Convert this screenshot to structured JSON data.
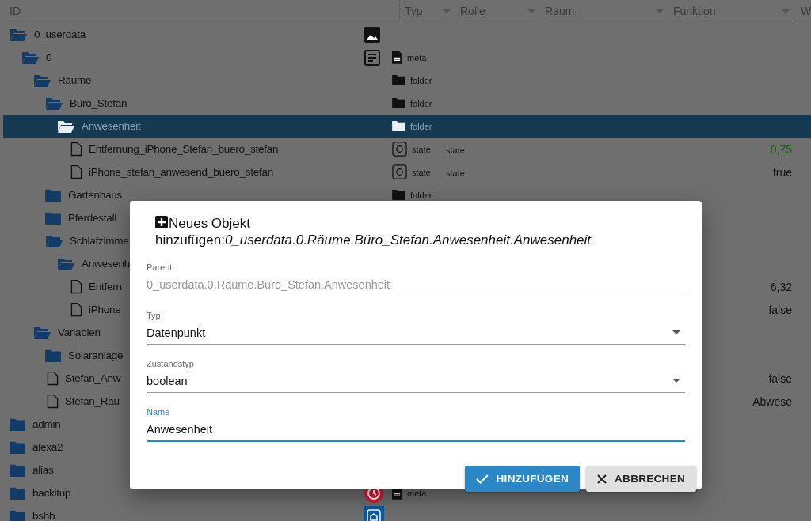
{
  "header": {
    "columns": [
      {
        "label": "ID",
        "kind": "text"
      },
      {
        "label": "Typ",
        "kind": "select"
      },
      {
        "label": "Rolle",
        "kind": "select"
      },
      {
        "label": "Raum",
        "kind": "select"
      },
      {
        "label": "Funktion",
        "kind": "select"
      },
      {
        "label": "W",
        "kind": "text"
      }
    ]
  },
  "tree": [
    {
      "name": "0_userdata",
      "kind": "folder",
      "expanded": true,
      "selected": false,
      "children": [
        {
          "name": "0",
          "kind": "folder",
          "expanded": true,
          "selected": false,
          "type": "meta",
          "children": [
            {
              "name": "Räume",
              "kind": "folder",
              "expanded": true,
              "selected": false,
              "type": "folder",
              "children": [
                {
                  "name": "Büro_Stefan",
                  "kind": "folder",
                  "expanded": true,
                  "selected": false,
                  "type": "folder",
                  "children": [
                    {
                      "name": "Anwesenheit",
                      "kind": "folder",
                      "expanded": true,
                      "selected": true,
                      "type": "folder",
                      "children": [
                        {
                          "name": "Entfernung_iPhone_Stefan_buero_stefan",
                          "kind": "file",
                          "selected": false,
                          "type": "state",
                          "role": "state",
                          "value": "0,75",
                          "color": "#16620a"
                        },
                        {
                          "name": "iPhone_stefan_anwesend_buero_stefan",
                          "kind": "file",
                          "selected": false,
                          "type": "state",
                          "role": "state",
                          "value": "true",
                          "color": "#111111"
                        }
                      ]
                    }
                  ]
                },
                {
                  "name": "Gartenhaus",
                  "kind": "folder",
                  "expanded": false,
                  "selected": false,
                  "type": "folder"
                },
                {
                  "name": "Pferdestall",
                  "kind": "folder",
                  "expanded": false,
                  "selected": false
                },
                {
                  "name": "Schlafzimme",
                  "kind": "folder",
                  "expanded": true,
                  "selected": false,
                  "children": [
                    {
                      "name": "Anwesenh",
                      "kind": "folder",
                      "expanded": true,
                      "selected": false,
                      "children": [
                        {
                          "name": "Entfern",
                          "kind": "file",
                          "selected": false,
                          "value": "6,32",
                          "color": "#111111"
                        },
                        {
                          "name": "iPhone_",
                          "kind": "file",
                          "selected": false,
                          "value": "false",
                          "color": "#111111"
                        }
                      ]
                    }
                  ]
                }
              ]
            },
            {
              "name": "Variablen",
              "kind": "folder",
              "expanded": true,
              "selected": false,
              "children": [
                {
                  "name": "Solaranlage",
                  "kind": "folder",
                  "expanded": false,
                  "selected": false
                },
                {
                  "name": "Stefan_Anw",
                  "kind": "file",
                  "selected": false,
                  "value": "false",
                  "color": "#111111"
                },
                {
                  "name": "Stefan_Rau",
                  "kind": "file",
                  "selected": false,
                  "value": "Abwese",
                  "color": "#111111"
                }
              ]
            }
          ]
        }
      ]
    },
    {
      "name": "admin",
      "kind": "folder",
      "expanded": false,
      "selected": false
    },
    {
      "name": "alexa2",
      "kind": "folder",
      "expanded": false,
      "selected": false
    },
    {
      "name": "alias",
      "kind": "folder",
      "expanded": false,
      "selected": false
    },
    {
      "name": "backitup",
      "kind": "folder",
      "expanded": false,
      "selected": false,
      "type": "meta"
    },
    {
      "name": "bshb",
      "kind": "folder",
      "expanded": false,
      "selected": false
    }
  ],
  "dialog": {
    "title": "Neues Objekt hinzufügen:*0_userdata.0.Räume.Büro_Stefan.Anwesenheit.Anwesenheit*",
    "fields": [
      {
        "label": "Parent",
        "kind": "text",
        "value": "0_userdata.0.Räume.Büro_Stefan.Anwesenheit",
        "disabled": true,
        "focused": false
      },
      {
        "label": "Typ",
        "kind": "select",
        "value": "Datenpunkt",
        "disabled": false,
        "focused": false
      },
      {
        "label": "Zustandstyp",
        "kind": "select",
        "value": "boolean",
        "disabled": false,
        "focused": false
      },
      {
        "label": "Name",
        "kind": "text",
        "value": "Anwesenheit",
        "disabled": false,
        "focused": true
      }
    ],
    "buttons": [
      {
        "label": "HINZUFÜGEN",
        "kind": "primary"
      },
      {
        "label": "ABBRECHEN",
        "kind": "cancel"
      }
    ]
  }
}
